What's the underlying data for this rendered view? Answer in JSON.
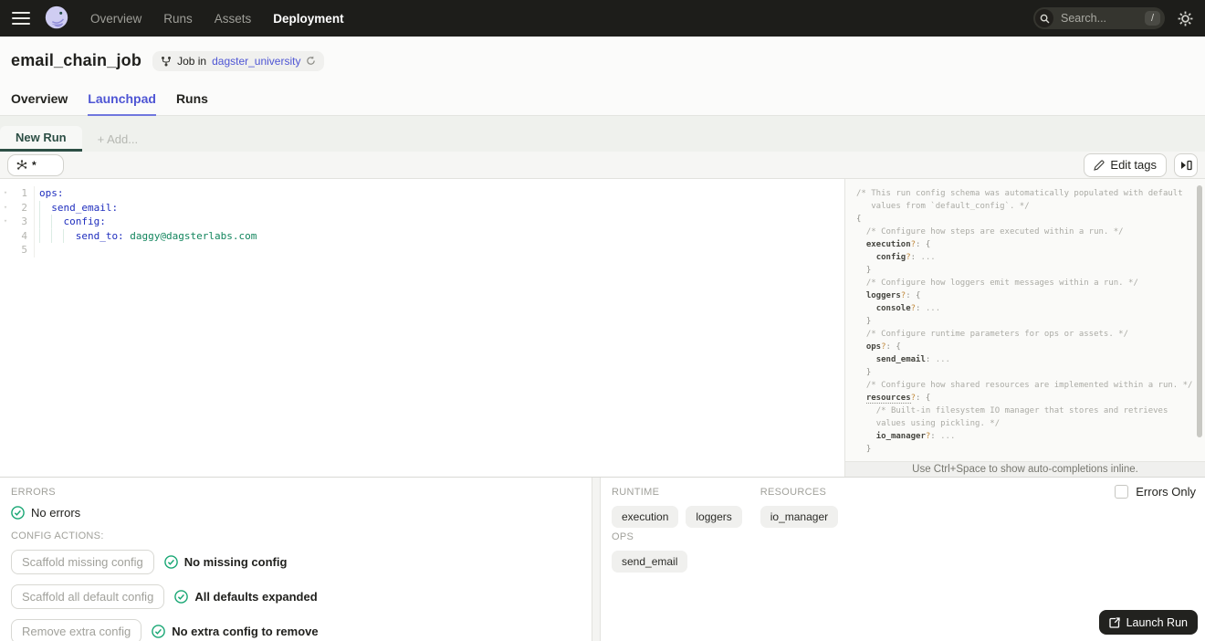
{
  "topbar": {
    "nav": [
      {
        "label": "Overview",
        "active": false
      },
      {
        "label": "Runs",
        "active": false
      },
      {
        "label": "Assets",
        "active": false
      },
      {
        "label": "Deployment",
        "active": true
      }
    ],
    "search": {
      "placeholder": "Search...",
      "shortcut": "/"
    }
  },
  "header": {
    "title": "email_chain_job",
    "job_pill": {
      "prefix": "Job in",
      "repo": "dagster_university"
    },
    "tabs": [
      {
        "label": "Overview",
        "active": false
      },
      {
        "label": "Launchpad",
        "active": true
      },
      {
        "label": "Runs",
        "active": false
      }
    ]
  },
  "launchpad": {
    "run_tab": "New Run",
    "add_tab": "+ Add...",
    "op_selector_value": "*",
    "edit_tags_label": "Edit tags"
  },
  "editor": {
    "lines": [
      {
        "n": "1",
        "fold": true,
        "indent": 0,
        "key": "ops:",
        "value": ""
      },
      {
        "n": "2",
        "fold": true,
        "indent": 1,
        "key": "send_email:",
        "value": ""
      },
      {
        "n": "3",
        "fold": true,
        "indent": 2,
        "key": "config:",
        "value": ""
      },
      {
        "n": "4",
        "fold": false,
        "indent": 3,
        "key": "send_to:",
        "value": " daggy@dagsterlabs.com"
      },
      {
        "n": "5",
        "fold": false,
        "indent": 0,
        "key": "",
        "value": ""
      }
    ]
  },
  "schema": {
    "lines": [
      [
        {
          "t": "c",
          "s": "/* This run config schema was automatically populated with default"
        }
      ],
      [
        {
          "t": "c",
          "s": "   values from `default_config`. */"
        }
      ],
      [
        {
          "t": "p",
          "s": "{"
        }
      ],
      [
        {
          "t": "p",
          "s": "  "
        },
        {
          "t": "c",
          "s": "/* Configure how steps are executed within a run. */"
        }
      ],
      [
        {
          "t": "p",
          "s": "  "
        },
        {
          "t": "k",
          "s": "execution"
        },
        {
          "t": "q",
          "s": "?"
        },
        {
          "t": "p",
          "s": ": {"
        }
      ],
      [
        {
          "t": "p",
          "s": "    "
        },
        {
          "t": "k",
          "s": "config"
        },
        {
          "t": "q",
          "s": "?"
        },
        {
          "t": "p",
          "s": ": "
        },
        {
          "t": "e",
          "s": "..."
        }
      ],
      [
        {
          "t": "p",
          "s": "  }"
        }
      ],
      [
        {
          "t": "p",
          "s": "  "
        },
        {
          "t": "c",
          "s": "/* Configure how loggers emit messages within a run. */"
        }
      ],
      [
        {
          "t": "p",
          "s": "  "
        },
        {
          "t": "k",
          "s": "loggers"
        },
        {
          "t": "q",
          "s": "?"
        },
        {
          "t": "p",
          "s": ": {"
        }
      ],
      [
        {
          "t": "p",
          "s": "    "
        },
        {
          "t": "k",
          "s": "console"
        },
        {
          "t": "q",
          "s": "?"
        },
        {
          "t": "p",
          "s": ": "
        },
        {
          "t": "e",
          "s": "..."
        }
      ],
      [
        {
          "t": "p",
          "s": "  }"
        }
      ],
      [
        {
          "t": "p",
          "s": "  "
        },
        {
          "t": "c",
          "s": "/* Configure runtime parameters for ops or assets. */"
        }
      ],
      [
        {
          "t": "p",
          "s": "  "
        },
        {
          "t": "k",
          "s": "ops"
        },
        {
          "t": "q",
          "s": "?"
        },
        {
          "t": "p",
          "s": ": {"
        }
      ],
      [
        {
          "t": "p",
          "s": "    "
        },
        {
          "t": "k",
          "s": "send_email"
        },
        {
          "t": "p",
          "s": ": "
        },
        {
          "t": "e",
          "s": "..."
        }
      ],
      [
        {
          "t": "p",
          "s": "  }"
        }
      ],
      [
        {
          "t": "p",
          "s": "  "
        },
        {
          "t": "c",
          "s": "/* Configure how shared resources are implemented within a run. */"
        }
      ],
      [
        {
          "t": "p",
          "s": "  "
        },
        {
          "t": "k",
          "s": "resources",
          "u": true
        },
        {
          "t": "q",
          "s": "?"
        },
        {
          "t": "p",
          "s": ": {"
        }
      ],
      [
        {
          "t": "p",
          "s": "    "
        },
        {
          "t": "c",
          "s": "/* Built-in filesystem IO manager that stores and retrieves"
        }
      ],
      [
        {
          "t": "p",
          "s": "    "
        },
        {
          "t": "c",
          "s": "values using pickling. */"
        }
      ],
      [
        {
          "t": "p",
          "s": "    "
        },
        {
          "t": "k",
          "s": "io_manager"
        },
        {
          "t": "q",
          "s": "?"
        },
        {
          "t": "p",
          "s": ": "
        },
        {
          "t": "e",
          "s": "..."
        }
      ],
      [
        {
          "t": "p",
          "s": "  }"
        }
      ]
    ],
    "hint": "Use Ctrl+Space to show auto-completions inline."
  },
  "bottom": {
    "errors_label": "ERRORS",
    "no_errors": "No errors",
    "config_actions_label": "CONFIG ACTIONS:",
    "actions": [
      {
        "button": "Scaffold missing config",
        "status": "No missing config"
      },
      {
        "button": "Scaffold all default config",
        "status": "All defaults expanded"
      },
      {
        "button": "Remove extra config",
        "status": "No extra config to remove"
      }
    ],
    "tag_rows": [
      [
        {
          "label": "RUNTIME",
          "tags": [
            "execution",
            "loggers"
          ]
        },
        {
          "label": "RESOURCES",
          "tags": [
            "io_manager"
          ]
        }
      ],
      [
        {
          "label": "OPS",
          "tags": [
            "send_email"
          ]
        }
      ]
    ],
    "errors_only_label": "Errors Only",
    "launch_run_label": "Launch Run"
  },
  "colors": {
    "accent_blue": "#4e55d4",
    "active_green": "#2d4f45",
    "status_green": "#17a673",
    "topbar_bg": "#1d1d1a"
  }
}
